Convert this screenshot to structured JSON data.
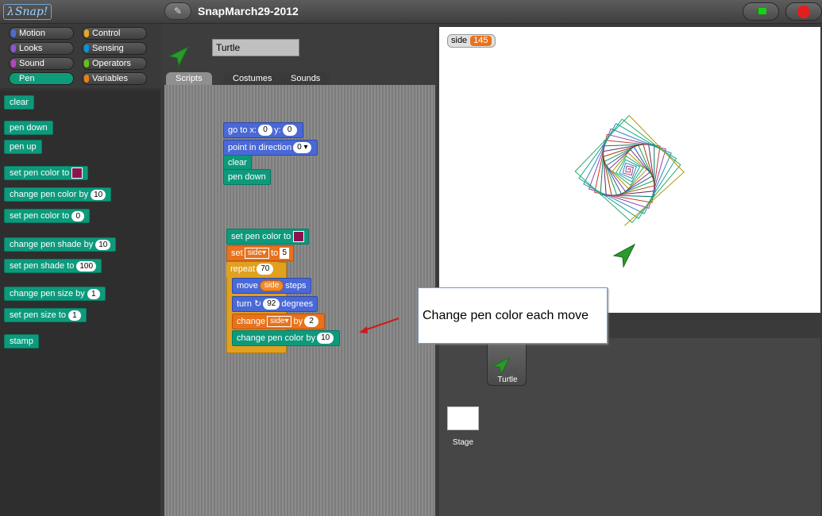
{
  "app": {
    "logo": "Snap!",
    "project_title": "SnapMarch29-2012"
  },
  "categories": [
    {
      "label": "Motion",
      "color": "#4a6cd4"
    },
    {
      "label": "Control",
      "color": "#e6a822"
    },
    {
      "label": "Looks",
      "color": "#8a55d7"
    },
    {
      "label": "Sensing",
      "color": "#0494dc"
    },
    {
      "label": "Sound",
      "color": "#bb42c3"
    },
    {
      "label": "Operators",
      "color": "#62c213"
    },
    {
      "label": "Pen",
      "color": "#0e9a6c"
    },
    {
      "label": "Variables",
      "color": "#ee7d16"
    }
  ],
  "palette_blocks": [
    {
      "label": "clear"
    },
    {
      "label": "pen down"
    },
    {
      "label": "pen up"
    },
    {
      "label": "set pen color to",
      "swatch": "#8b1450"
    },
    {
      "label": "change pen color by",
      "value": "10"
    },
    {
      "label": "set pen color to",
      "value": "0"
    },
    {
      "label": "change pen shade by",
      "value": "10"
    },
    {
      "label": "set pen shade to",
      "value": "100"
    },
    {
      "label": "change pen size by",
      "value": "1"
    },
    {
      "label": "set pen size to",
      "value": "1"
    },
    {
      "label": "stamp"
    }
  ],
  "sprite": {
    "name": "Turtle",
    "tabs": [
      "Scripts",
      "Costumes",
      "Sounds"
    ]
  },
  "script1": {
    "goto_label": "go to x:",
    "goto_x": "0",
    "goto_y_label": "y:",
    "goto_y": "0",
    "point_label": "point in direction",
    "point_value": "0",
    "clear_label": "clear",
    "pendown_label": "pen down"
  },
  "script2": {
    "setcolor_label": "set pen color to",
    "set_label": "set",
    "set_var": "side",
    "set_to": "to",
    "set_value": "5",
    "repeat_label": "repeat",
    "repeat_value": "70",
    "move_label": "move",
    "move_var": "side",
    "move_steps": "steps",
    "turn_label": "turn ↻",
    "turn_value": "92",
    "turn_degrees": "degrees",
    "change_label": "change",
    "change_var": "side",
    "change_by": "by",
    "change_value": "2",
    "changecolor_label": "change pen color by",
    "changecolor_value": "10"
  },
  "watcher": {
    "name": "side",
    "value": "145"
  },
  "corral": {
    "sprite_label": "Turtle",
    "stage_label": "Stage"
  },
  "callout": {
    "text": "Change pen color each move"
  },
  "colors": {
    "pen_swatch": "#8b1450",
    "pen_category": "#0e9a6c",
    "turtle": "#2a9a2a"
  }
}
